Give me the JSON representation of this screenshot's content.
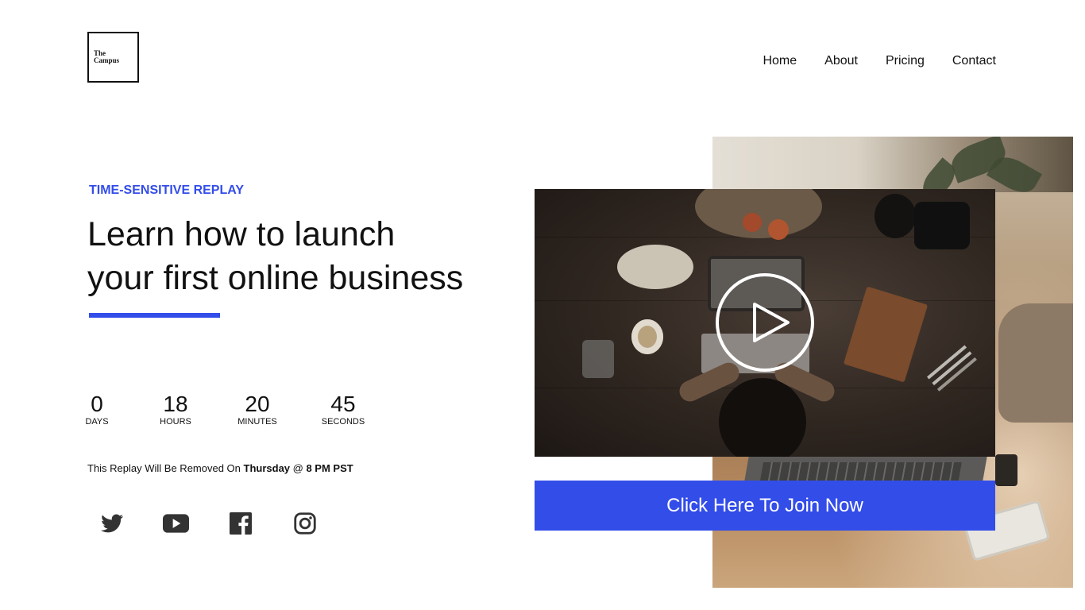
{
  "brand": {
    "logo_line1": "The",
    "logo_line2": "Campus"
  },
  "nav": {
    "items": [
      "Home",
      "About",
      "Pricing",
      "Contact"
    ]
  },
  "hero": {
    "eyebrow": "TIME-SENSITIVE REPLAY",
    "headline_line1": "Learn how to launch",
    "headline_line2": "your first online business"
  },
  "countdown": {
    "days": {
      "value": "0",
      "label": "DAYS"
    },
    "hours": {
      "value": "18",
      "label": "HOURS"
    },
    "minutes": {
      "value": "20",
      "label": "MINUTES"
    },
    "seconds": {
      "value": "45",
      "label": "SECONDS"
    }
  },
  "notice": {
    "prefix": "This Replay Will Be Removed On ",
    "day": "Thursday",
    "at": " @ ",
    "time": "8 PM PST"
  },
  "socials": {
    "icons": [
      "twitter-icon",
      "youtube-icon",
      "facebook-icon",
      "instagram-icon"
    ]
  },
  "video": {
    "icon": "play-icon"
  },
  "cta": {
    "label": "Click Here To Join Now"
  },
  "colors": {
    "accent": "#334de9",
    "text": "#111111",
    "background": "#ffffff",
    "social_icon": "#333333"
  }
}
